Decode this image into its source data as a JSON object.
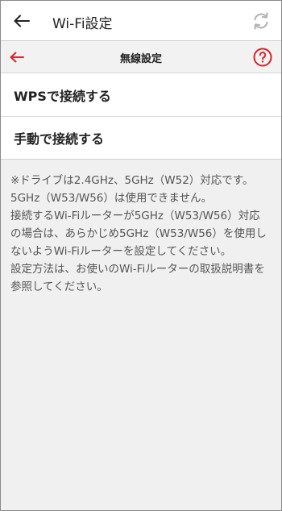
{
  "appbar": {
    "title": "Wi-Fi設定",
    "back_icon": "arrow-left-icon",
    "sync_icon": "sync-icon"
  },
  "subbar": {
    "title": "無線設定",
    "back_icon": "arrow-left-icon",
    "help_icon": "question-circle-icon"
  },
  "menu": {
    "items": [
      {
        "label": "WPSで接続する"
      },
      {
        "label": "手動で接続する"
      }
    ]
  },
  "note": {
    "text": "※ドライブは2.4GHz、5GHz（W52）対応です。5GHz（W53/W56）は使用できません。\n接続するWi-Fiルーターが5GHz（W53/W56）対応の場合は、あらかじめ5GHz（W53/W56）を使用しないようWi-Fiルーターを設定してください。\n設定方法は、お使いのWi-Fiルーターの取扱説明書を参照してください。"
  },
  "colors": {
    "accent": "#d9222a",
    "icon_gray": "#b5b5b5",
    "background": "#f0f0f0"
  }
}
